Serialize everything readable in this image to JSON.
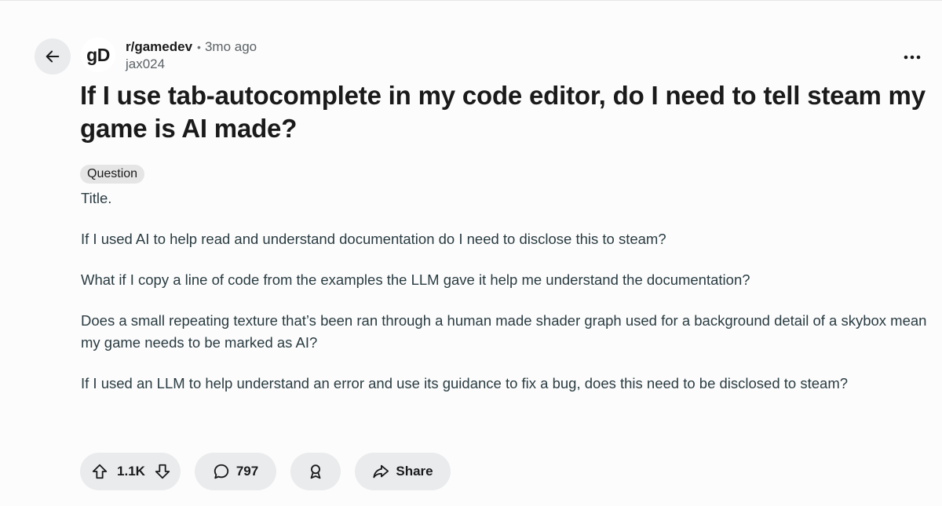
{
  "post": {
    "subreddit": "r/gamedev",
    "separator": "•",
    "time_ago": "3mo ago",
    "author": "jax024",
    "avatar_text": "gD",
    "title": "If I use tab-autocomplete in my code editor, do I need to tell steam my game is AI made?",
    "flair": "Question",
    "body": [
      "Title.",
      "If I used AI to help read and understand documentation do I need to disclose this to steam?",
      "What if I copy a line of code from the examples the LLM gave it help me understand the documentation?",
      "Does a small repeating texture that’s been ran through a human made shader graph used for a background detail of a skybox mean my game needs to be marked as AI?",
      "If I used an LLM to help understand an error and use its guidance to fix a bug, does this need to be disclosed to steam?"
    ]
  },
  "actions": {
    "vote_count": "1.1K",
    "comment_count": "797",
    "share_label": "Share"
  },
  "icons": {
    "back": "arrow-left-icon",
    "more": "more-options-icon",
    "upvote": "upvote-arrow-icon",
    "downvote": "downvote-arrow-icon",
    "comment": "comment-bubble-icon",
    "award": "award-icon",
    "share": "share-arrow-icon"
  }
}
